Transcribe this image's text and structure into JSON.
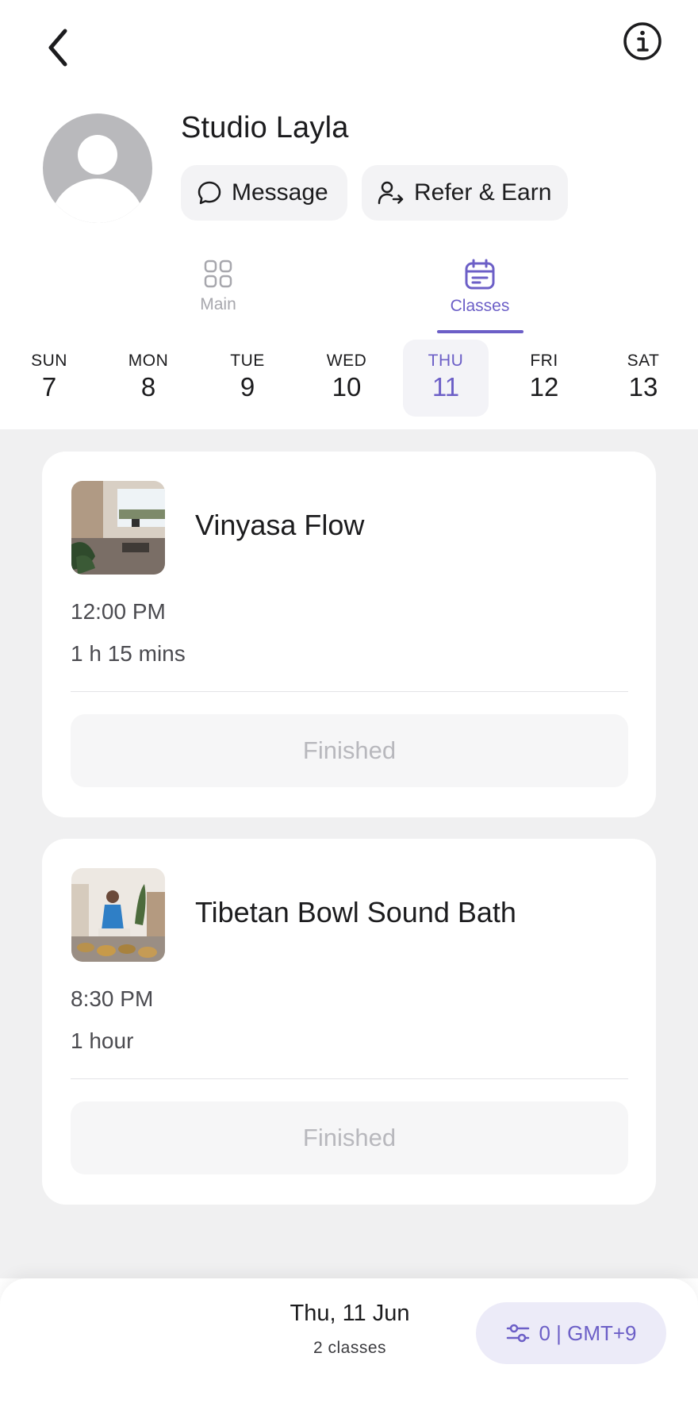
{
  "header": {
    "back_icon": "chevron-left-icon",
    "info_icon": "info-circle-icon"
  },
  "profile": {
    "name": "Studio Layla",
    "message_label": "Message",
    "refer_label": "Refer & Earn"
  },
  "tabs": [
    {
      "label": "Main",
      "icon": "grid-icon",
      "active": false
    },
    {
      "label": "Classes",
      "icon": "calendar-icon",
      "active": true
    }
  ],
  "week": [
    {
      "name": "SUN",
      "num": "7"
    },
    {
      "name": "MON",
      "num": "8"
    },
    {
      "name": "TUE",
      "num": "9"
    },
    {
      "name": "WED",
      "num": "10"
    },
    {
      "name": "THU",
      "num": "11",
      "selected": true
    },
    {
      "name": "FRI",
      "num": "12"
    },
    {
      "name": "SAT",
      "num": "13"
    }
  ],
  "classes": [
    {
      "title": "Vinyasa Flow",
      "time": "12:00 PM",
      "duration": "1 h 15 mins",
      "status": "Finished"
    },
    {
      "title": "Tibetan Bowl Sound Bath",
      "time": "8:30 PM",
      "duration": "1 hour",
      "status": "Finished"
    }
  ],
  "footer": {
    "date": "Thu, 11 Jun",
    "count": "2 classes",
    "tz_label": "0 | GMT+9",
    "tz_icon": "sliders-icon"
  },
  "colors": {
    "accent": "#6c5fc7",
    "list_background": "#f0f0f1"
  }
}
